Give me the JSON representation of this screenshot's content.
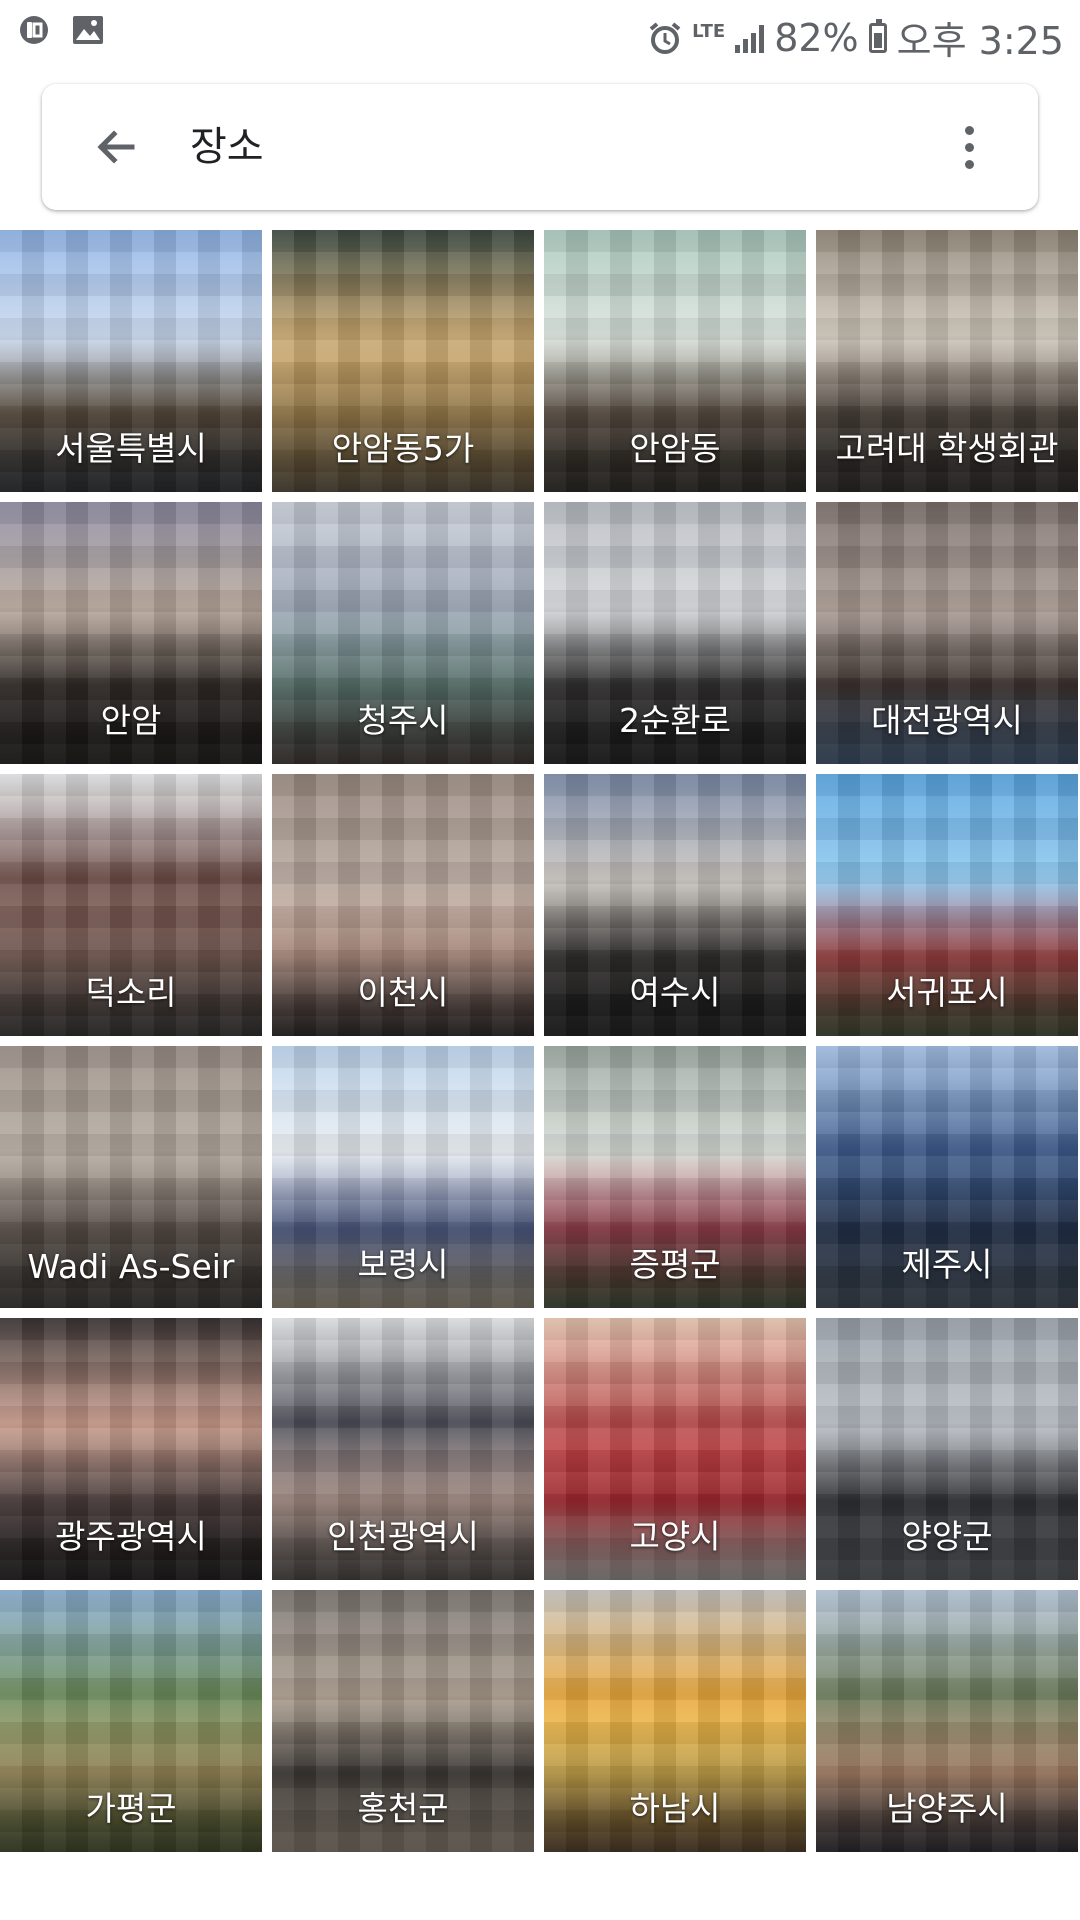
{
  "status_bar": {
    "time": "오후 3:25",
    "battery": "82%",
    "network": "LTE"
  },
  "header": {
    "title": "장소"
  },
  "places": [
    {
      "label": "서울특별시",
      "colors": [
        "#8fb3e6",
        "#c8d8ee",
        "#6a5a48",
        "#3a3e44"
      ]
    },
    {
      "label": "안암동5가",
      "colors": [
        "#3d4a42",
        "#c8a66e",
        "#b9965a",
        "#7a6a50"
      ]
    },
    {
      "label": "안암동",
      "colors": [
        "#a9c8bc",
        "#d9e2dc",
        "#6b5e50",
        "#3c3832"
      ]
    },
    {
      "label": "고려대 학생회관",
      "colors": [
        "#8e8474",
        "#cfc8bc",
        "#5a5046",
        "#3e3a36"
      ]
    },
    {
      "label": "안암",
      "colors": [
        "#8c8aa0",
        "#b7a79a",
        "#3c3430",
        "#2a2826"
      ]
    },
    {
      "label": "청주시",
      "colors": [
        "#c9ced8",
        "#9aa4b4",
        "#6c8c84",
        "#5a4e48"
      ]
    },
    {
      "label": "2순환로",
      "colors": [
        "#b7bcc2",
        "#d4d7da",
        "#3c3a3a",
        "#2c2a2c"
      ]
    },
    {
      "label": "대전광역시",
      "colors": [
        "#7a6e6a",
        "#a89a92",
        "#4a3e3a",
        "#5a7aa2"
      ]
    },
    {
      "label": "덕소리",
      "colors": [
        "#e6e8ea",
        "#6a4a44",
        "#8a6a60",
        "#4a4846"
      ]
    },
    {
      "label": "이천시",
      "colors": [
        "#9a8a80",
        "#b4a69c",
        "#d0a898",
        "#3a3434"
      ]
    },
    {
      "label": "여수시",
      "colors": [
        "#7a8aa8",
        "#c8c4be",
        "#3a3836",
        "#2a2a2c"
      ]
    },
    {
      "label": "서귀포시",
      "colors": [
        "#5aa6e2",
        "#8cc6ee",
        "#b84a4a",
        "#5a6a4a"
      ]
    },
    {
      "label": "Wadi As-Seir",
      "colors": [
        "#9a8e86",
        "#b2a89e",
        "#6a5e56",
        "#4e4a46"
      ]
    },
    {
      "label": "보령시",
      "colors": [
        "#bcd4ee",
        "#e8ecf0",
        "#5a6a9a",
        "#d4c4a8"
      ]
    },
    {
      "label": "증평군",
      "colors": [
        "#9aa6a0",
        "#d6dcd6",
        "#b04a5a",
        "#5a6a4a"
      ]
    },
    {
      "label": "제주시",
      "colors": [
        "#a8c4e8",
        "#3a5a8a",
        "#2a3a5a",
        "#5a6a7a"
      ]
    },
    {
      "label": "광주광역시",
      "colors": [
        "#3a3434",
        "#c89a8a",
        "#5a4a48",
        "#2a2626"
      ]
    },
    {
      "label": "인천광역시",
      "colors": [
        "#e6e8ea",
        "#4a4c56",
        "#c8aaa0",
        "#6a6460"
      ]
    },
    {
      "label": "고양시",
      "colors": [
        "#eac8b4",
        "#b84a4a",
        "#c8323a",
        "#e6e2de"
      ]
    },
    {
      "label": "양양군",
      "colors": [
        "#9aa2aa",
        "#b8bec4",
        "#3a3c40",
        "#7a8088"
      ]
    },
    {
      "label": "가평군",
      "colors": [
        "#8aaed2",
        "#6a8a5a",
        "#b8a46a",
        "#5a6a3a"
      ]
    },
    {
      "label": "홍천군",
      "colors": [
        "#7a7470",
        "#a89a8a",
        "#4a4440",
        "#c8b8a4"
      ]
    },
    {
      "label": "하남시",
      "colors": [
        "#c8c4c0",
        "#e8a63a",
        "#f0c85a",
        "#7a5a3a"
      ]
    },
    {
      "label": "남양주시",
      "colors": [
        "#b8c8dc",
        "#6a7a5a",
        "#c89a7a",
        "#3a3a44"
      ]
    }
  ]
}
